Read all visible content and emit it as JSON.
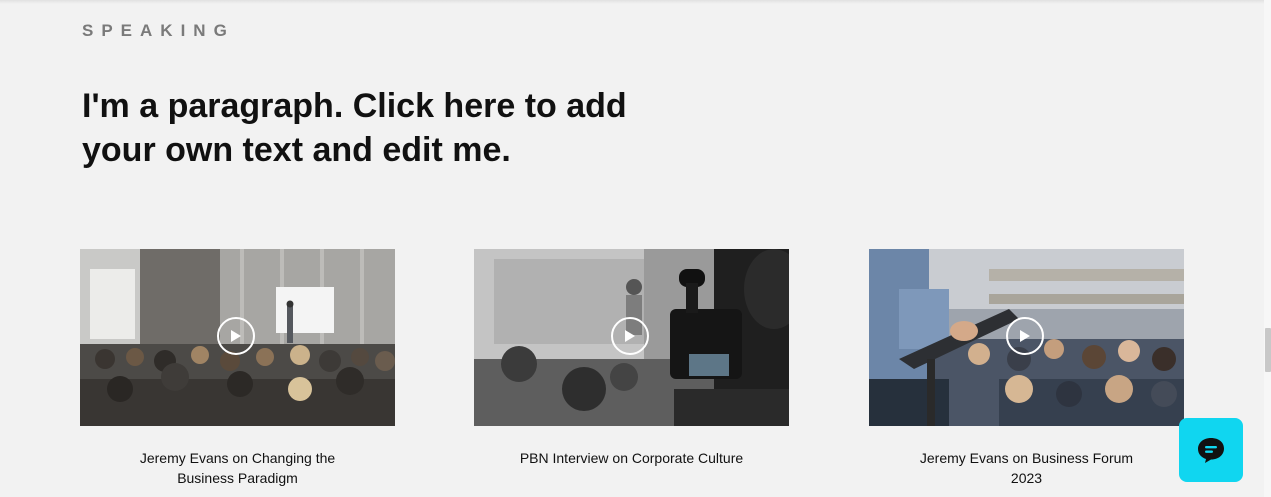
{
  "section": {
    "label": "SPEAKING",
    "headline": "I'm a paragraph. Click here to add your own text and edit me."
  },
  "videos": [
    {
      "title": "Jeremy Evans on Changing the Business Paradigm",
      "thumbnail": "conference-hall-speaker"
    },
    {
      "title": "PBN Interview on Corporate Culture",
      "thumbnail": "video-camera-interview"
    },
    {
      "title": "Jeremy Evans on Business Forum 2023",
      "thumbnail": "speaker-tablet-audience"
    }
  ],
  "chat": {
    "icon": "chat-bubble-icon",
    "color": "#10d6f0"
  },
  "colors": {
    "background": "#f2f2f2",
    "label": "#7a7a7a",
    "text": "#111111"
  }
}
